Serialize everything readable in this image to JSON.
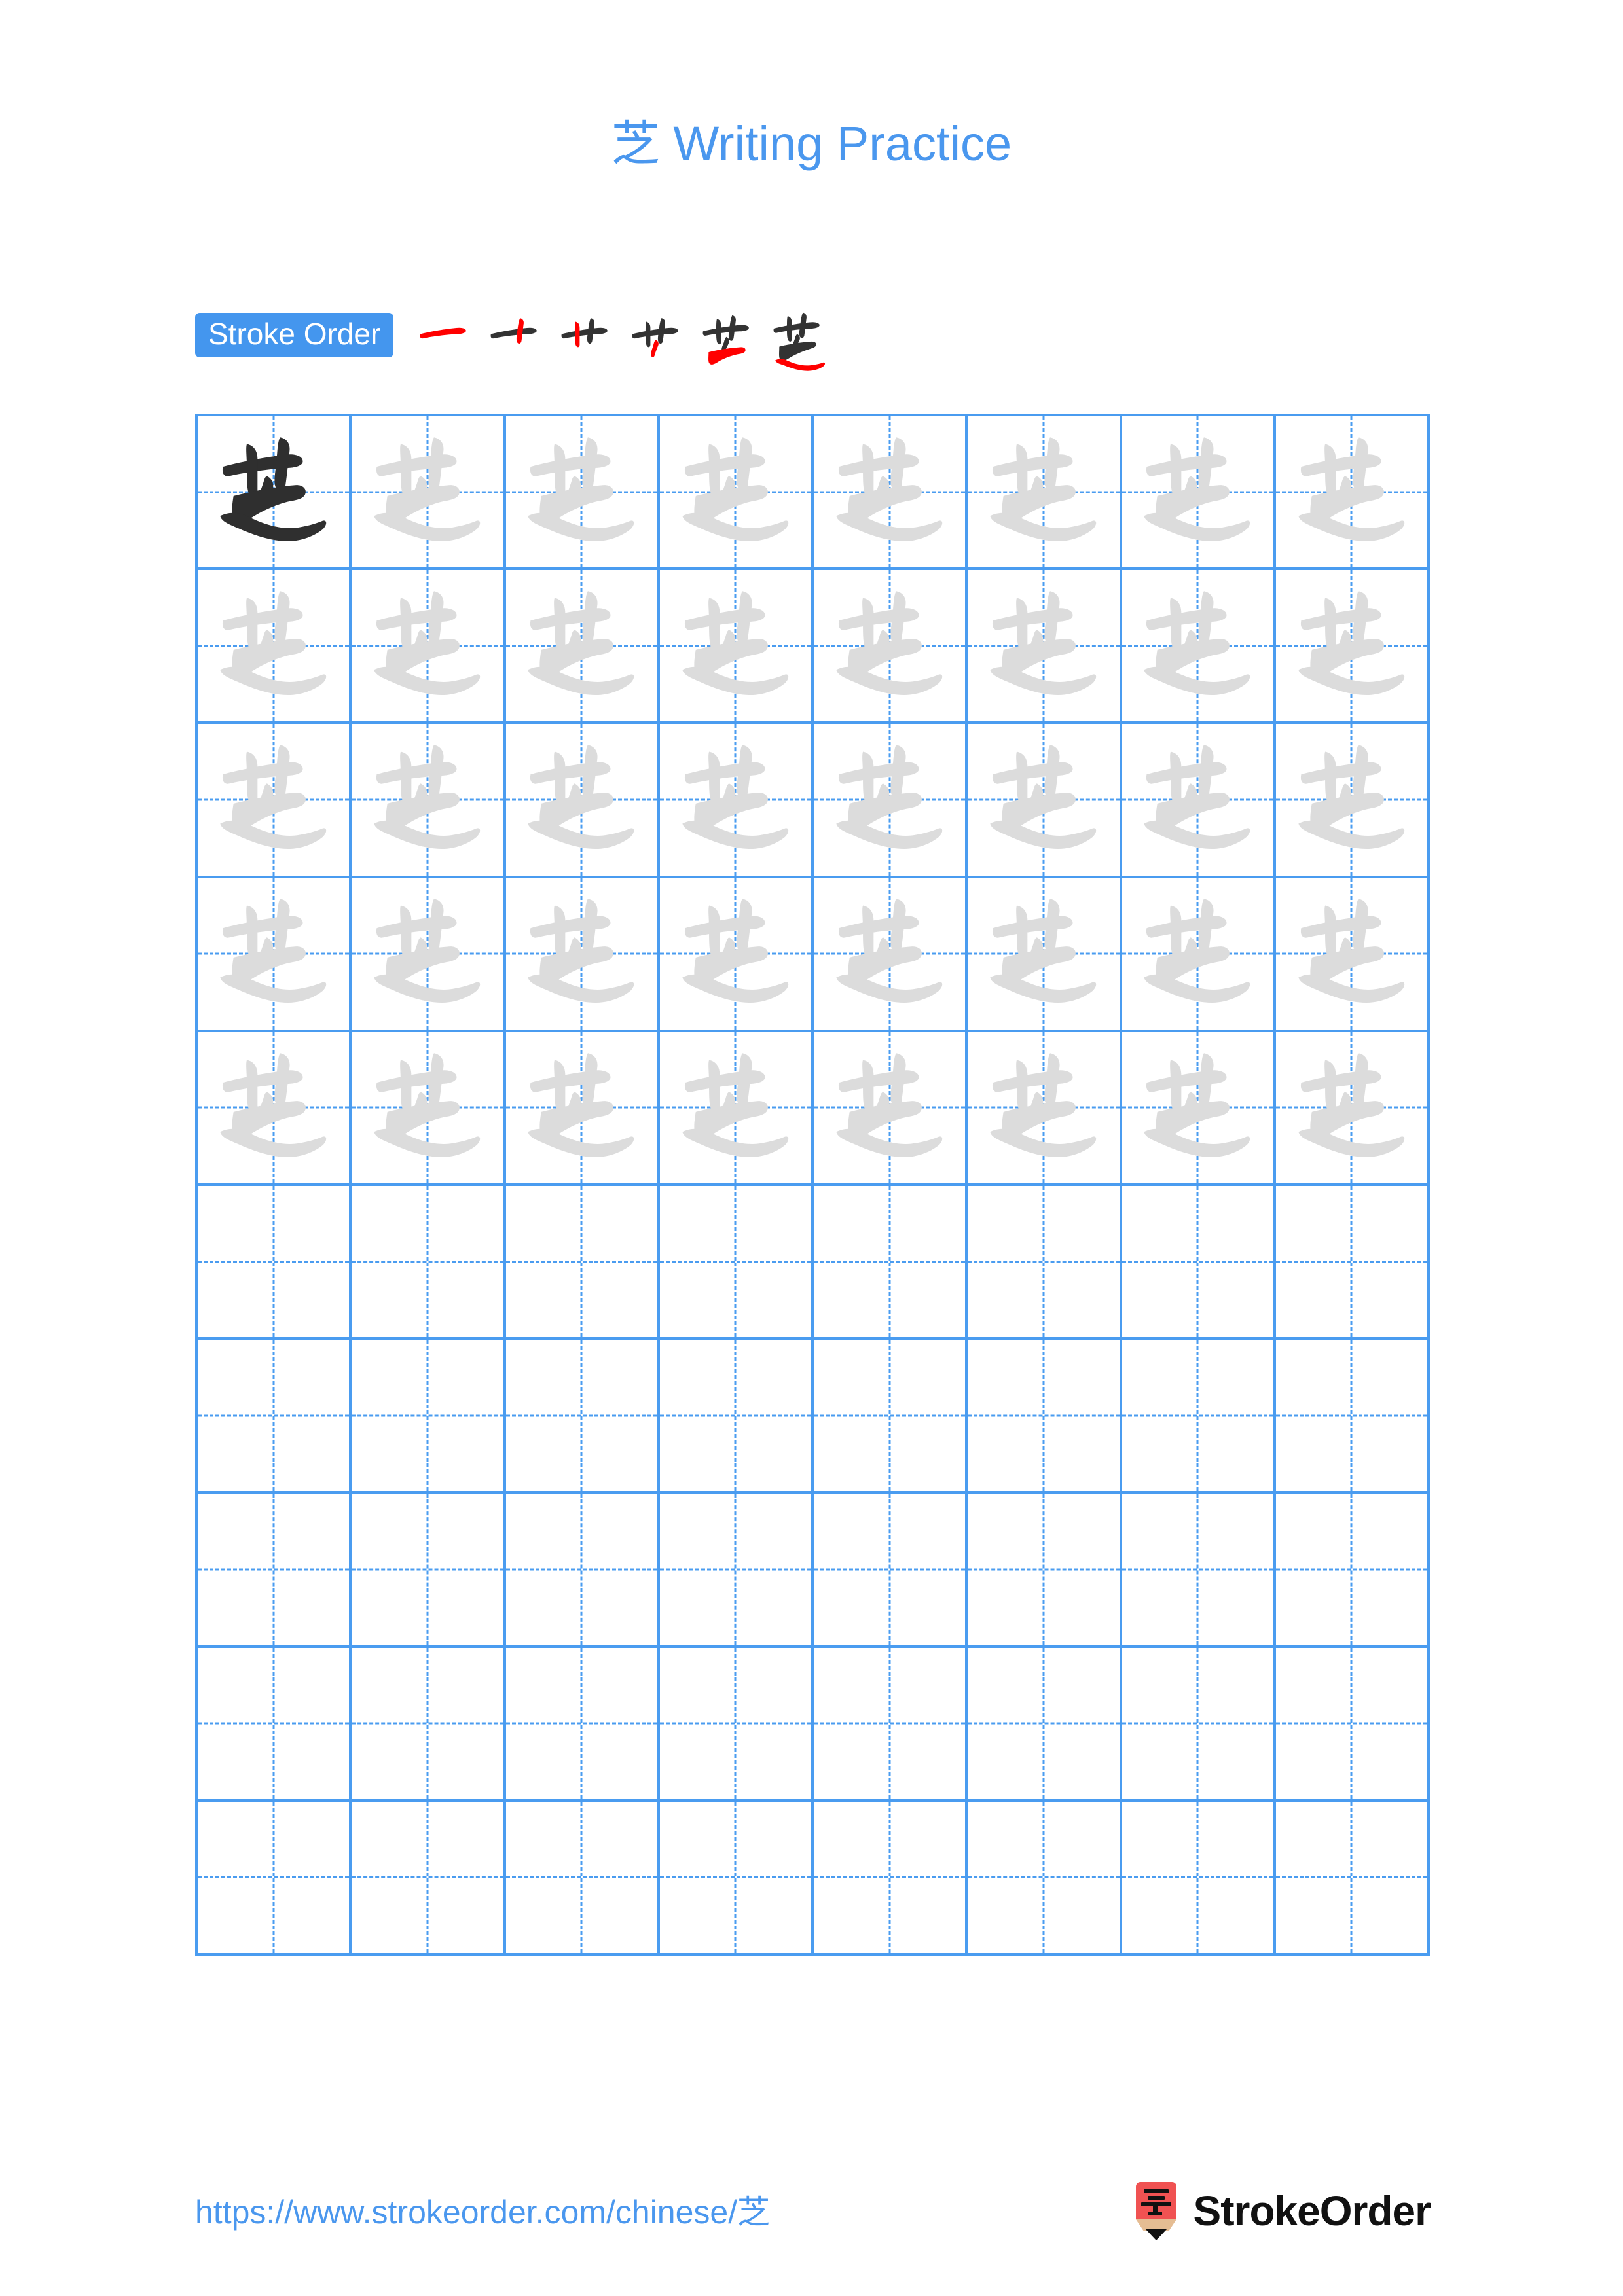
{
  "character": "芝",
  "page": {
    "title": "芝 Writing Practice",
    "background_color": "#ffffff",
    "accent_color": "#4a97ee",
    "grid_line_color": "#4a9cf0"
  },
  "stroke_order": {
    "badge_label": "Stroke Order",
    "badge_bg_color": "#4496ee",
    "badge_text_color": "#ffffff",
    "total_strokes": 6,
    "new_stroke_color": "#ff0000",
    "old_stroke_color": "#333333",
    "steps": [
      {
        "index": 1,
        "strokes_shown": 1,
        "description": "horizontal"
      },
      {
        "index": 2,
        "strokes_shown": 2,
        "description": "vertical"
      },
      {
        "index": 3,
        "strokes_shown": 3,
        "description": "vertical"
      },
      {
        "index": 4,
        "strokes_shown": 4,
        "description": "vertical"
      },
      {
        "index": 5,
        "strokes_shown": 5,
        "description": "horizontal-fold-throw"
      },
      {
        "index": 6,
        "strokes_shown": 6,
        "description": "press"
      }
    ]
  },
  "grid": {
    "columns": 8,
    "rows": 10,
    "filled_rows": 5,
    "dark_cell_index": 0,
    "dark_char_color": "#2f2f2f",
    "light_char_color": "#dcdcdc",
    "cells": [
      "dark",
      "light",
      "light",
      "light",
      "light",
      "light",
      "light",
      "light",
      "light",
      "light",
      "light",
      "light",
      "light",
      "light",
      "light",
      "light",
      "light",
      "light",
      "light",
      "light",
      "light",
      "light",
      "light",
      "light",
      "light",
      "light",
      "light",
      "light",
      "light",
      "light",
      "light",
      "light",
      "light",
      "light",
      "light",
      "light",
      "light",
      "light",
      "light",
      "light",
      "empty",
      "empty",
      "empty",
      "empty",
      "empty",
      "empty",
      "empty",
      "empty",
      "empty",
      "empty",
      "empty",
      "empty",
      "empty",
      "empty",
      "empty",
      "empty",
      "empty",
      "empty",
      "empty",
      "empty",
      "empty",
      "empty",
      "empty",
      "empty",
      "empty",
      "empty",
      "empty",
      "empty",
      "empty",
      "empty",
      "empty",
      "empty",
      "empty",
      "empty",
      "empty",
      "empty",
      "empty",
      "empty",
      "empty",
      "empty"
    ]
  },
  "footer": {
    "url": "https://www.strokeorder.com/chinese/芝",
    "brand_name": "StrokeOrder",
    "brand_mark_char": "字",
    "brand_mark_color": "#f05252",
    "brand_mark_wood_color": "#e5bd93",
    "brand_mark_tip_color": "#111111"
  }
}
